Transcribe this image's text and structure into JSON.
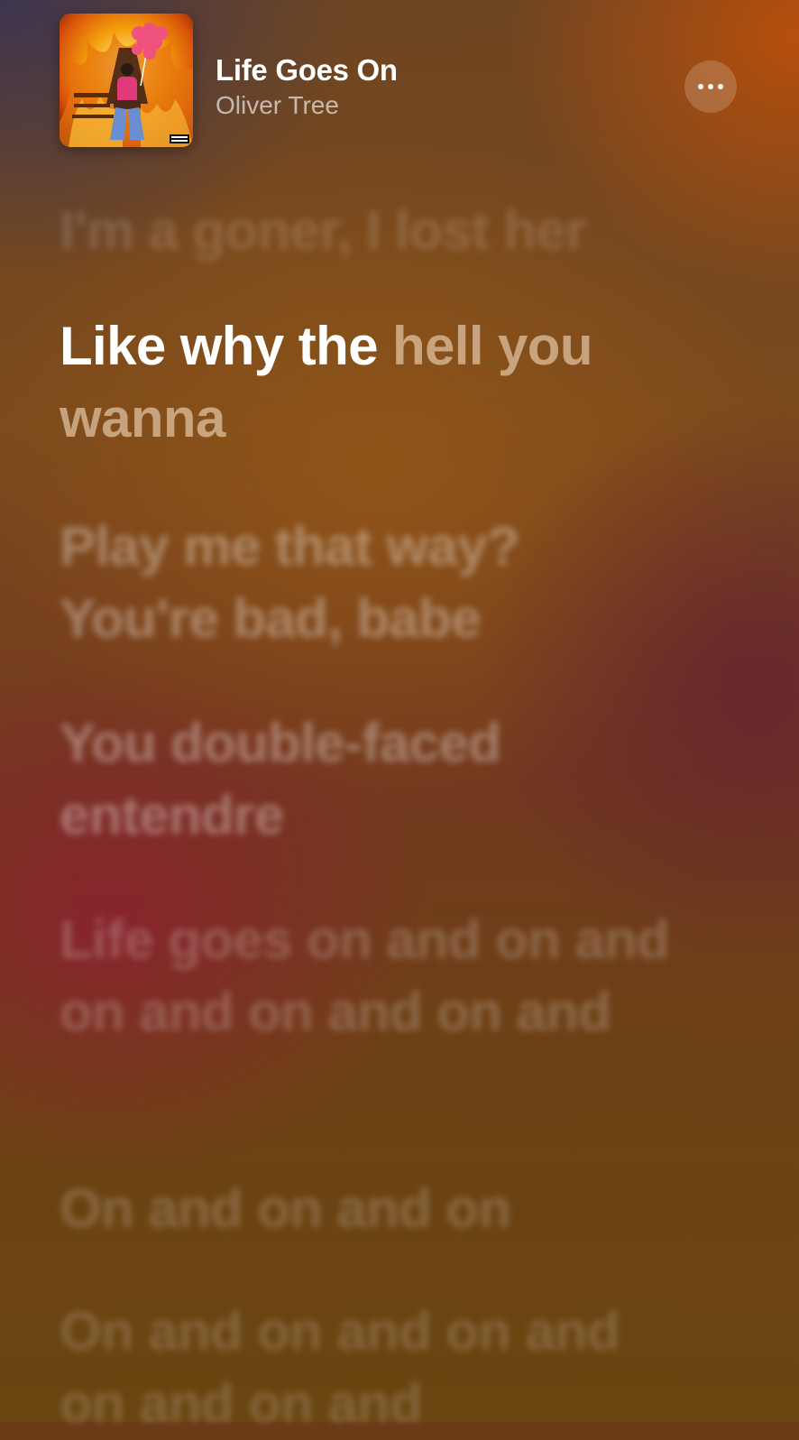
{
  "now_playing": {
    "title": "Life Goes On",
    "artist": "Oliver Tree",
    "explicit_badge": "PARENTAL ADVISORY",
    "album_art_icon": "album-cover-fire"
  },
  "controls": {
    "more_icon": "ellipsis-icon"
  },
  "lyrics": {
    "previous": "I'm a goner, I lost her",
    "current": {
      "sung": "Like why the",
      "upcoming": "hell you wanna"
    },
    "next": [
      "Play me that way? You're bad, babe",
      "You double-faced entendre",
      "Life goes on and on and on and on and on and",
      "On and on and on",
      "On and on and on and on and on and"
    ]
  },
  "colors": {
    "accent_top_left": "#3a3452",
    "accent_top_right": "#be500a",
    "accent_mid": "#8c2030",
    "accent_bottom": "#6a4510"
  }
}
